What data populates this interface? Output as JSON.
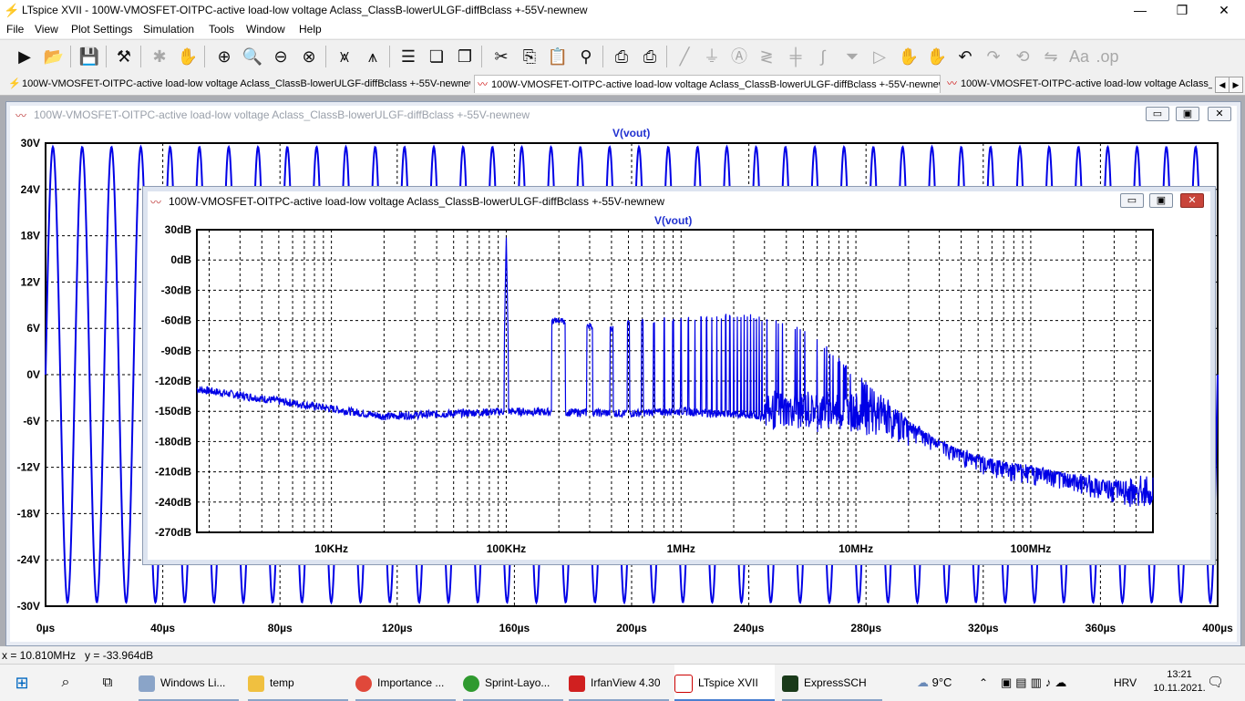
{
  "window": {
    "title": "LTspice XVII - 100W-VMOSFET-OITPC-active load-low voltage Aclass_ClassB-lowerULGF-diffBclass +-55V-newnew",
    "minimize": "—",
    "maximize": "❐",
    "close": "✕"
  },
  "menu": [
    "File",
    "View",
    "Plot Settings",
    "Simulation",
    "Tools",
    "Window",
    "Help"
  ],
  "tabs": [
    {
      "label": "100W-VMOSFET-OITPC-active load-low voltage Aclass_ClassB-lowerULGF-diffBclass +-55V-newnew"
    },
    {
      "label": "100W-VMOSFET-OITPC-active load-low voltage Aclass_ClassB-lowerULGF-diffBclass +-55V-newnew"
    },
    {
      "label": "100W-VMOSFET-OITPC-active load-low voltage Aclass_ClassB-lowerULGF-diffBclass +-55V-newnew"
    }
  ],
  "tab_scroll": {
    "left": "◀",
    "right": "▶"
  },
  "plot1": {
    "title": "100W-VMOSFET-OITPC-active load-low voltage Aclass_ClassB-lowerULGF-diffBclass +-55V-newnew",
    "min": "▭",
    "max": "▣",
    "close": "✕"
  },
  "plot2": {
    "title": "100W-VMOSFET-OITPC-active load-low voltage Aclass_ClassB-lowerULGF-diffBclass +-55V-newnew",
    "min": "▭",
    "max": "▣",
    "close": "✕"
  },
  "colors": {
    "trace": "#0000e6",
    "label": "#2030d0",
    "grid": "#000000"
  },
  "chart_data": [
    {
      "type": "line",
      "title": "V(vout)",
      "xlabel": "",
      "ylabel": "",
      "x_ticks": [
        "0µs",
        "40µs",
        "80µs",
        "120µs",
        "160µs",
        "200µs",
        "240µs",
        "280µs",
        "320µs",
        "360µs",
        "400µs"
      ],
      "y_ticks": [
        "30V",
        "24V",
        "18V",
        "12V",
        "6V",
        "0V",
        "-6V",
        "-12V",
        "-18V",
        "-24V",
        "-30V"
      ],
      "xlim": [
        0,
        400
      ],
      "ylim": [
        -30,
        30
      ],
      "grid": true,
      "series": [
        {
          "frequency_khz": 100,
          "amplitude_v": 29.5
        }
      ]
    },
    {
      "type": "line",
      "title": "V(vout)",
      "xlabel": "",
      "ylabel": "",
      "log_x": true,
      "x_ticks": [
        "10KHz",
        "100KHz",
        "1MHz",
        "10MHz",
        "100MHz"
      ],
      "y_ticks": [
        "30dB",
        "0dB",
        "-30dB",
        "-60dB",
        "-90dB",
        "-120dB",
        "-150dB",
        "-180dB",
        "-210dB",
        "-240dB",
        "-270dB"
      ],
      "xlim_hz": [
        1700,
        500000000
      ],
      "ylim": [
        -270,
        30
      ],
      "grid": true,
      "series": [
        {
          "points": [
            [
              1700,
              -128
            ],
            [
              3000,
              -133
            ],
            [
              5000,
              -145
            ],
            [
              7000,
              -158
            ],
            [
              10000,
              -157
            ],
            [
              20000,
              -152
            ],
            [
              40000,
              -150
            ],
            [
              70000,
              -152
            ],
            [
              90000,
              -150
            ],
            [
              100000,
              25
            ],
            [
              200000,
              -60
            ],
            [
              300000,
              -65
            ],
            [
              400000,
              -68
            ],
            [
              500000,
              -63
            ],
            [
              700000,
              -60
            ],
            [
              1000000,
              -58
            ],
            [
              2000000,
              -55
            ],
            [
              3000000,
              -58
            ],
            [
              5000000,
              -70
            ],
            [
              7000000,
              -90
            ],
            [
              10000000,
              -115
            ],
            [
              15000000,
              -140
            ],
            [
              20000000,
              -160
            ],
            [
              30000000,
              -180
            ],
            [
              50000000,
              -195
            ],
            [
              100000000,
              -205
            ],
            [
              200000000,
              -215
            ],
            [
              300000000,
              -220
            ],
            [
              500000000,
              -215
            ]
          ],
          "floor": [
            [
              1700,
              -128
            ],
            [
              20000,
              -155
            ],
            [
              100000,
              -150
            ],
            [
              500000,
              -152
            ],
            [
              1000000,
              -150
            ],
            [
              3000000,
              -155
            ],
            [
              10000000,
              -158
            ],
            [
              20000000,
              -170
            ],
            [
              50000000,
              -205
            ],
            [
              100000000,
              -215
            ],
            [
              200000000,
              -225
            ],
            [
              500000000,
              -240
            ]
          ]
        }
      ]
    }
  ],
  "status": {
    "readout": "x = 10.810MHz   y = -33.964dB"
  },
  "taskbar": {
    "items": [
      "Windows Li...",
      "temp",
      "Importance ...",
      "Sprint-Layo...",
      "IrfanView 4.30",
      "LTspice XVII",
      "ExpressSCH"
    ],
    "weather": "9°C",
    "lang": "HRV",
    "time": "13:21",
    "date": "10.11.2021."
  }
}
